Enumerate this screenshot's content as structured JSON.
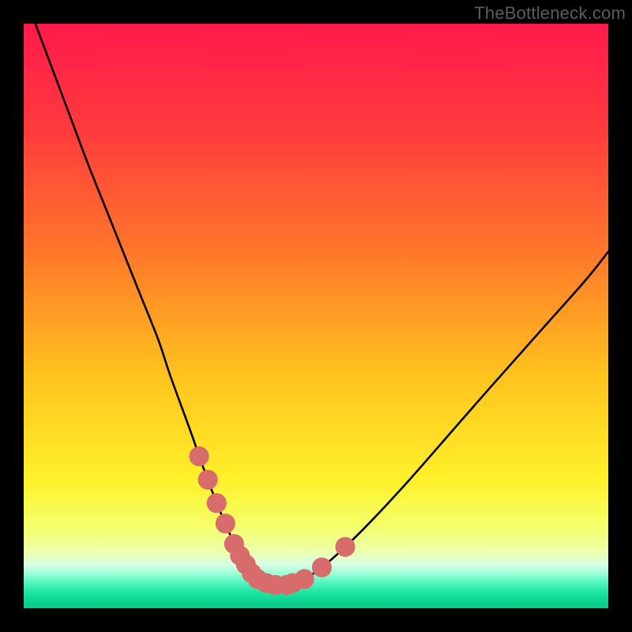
{
  "watermark": "TheBottleneck.com",
  "colors": {
    "frame": "#000000",
    "curve": "#000000",
    "marker": "#d86b6b",
    "gradient_stops": [
      {
        "offset": 0.0,
        "color": "#ff1a4b"
      },
      {
        "offset": 0.18,
        "color": "#ff3a3d"
      },
      {
        "offset": 0.4,
        "color": "#ff7a2a"
      },
      {
        "offset": 0.6,
        "color": "#ffc21e"
      },
      {
        "offset": 0.78,
        "color": "#fff12a"
      },
      {
        "offset": 0.86,
        "color": "#f4ff6a"
      },
      {
        "offset": 0.905,
        "color": "#ecffb0"
      },
      {
        "offset": 0.925,
        "color": "#d8ffe6"
      },
      {
        "offset": 0.94,
        "color": "#9fffd8"
      },
      {
        "offset": 0.955,
        "color": "#57f7c2"
      },
      {
        "offset": 0.972,
        "color": "#1fe6a3"
      },
      {
        "offset": 0.986,
        "color": "#0fd692"
      },
      {
        "offset": 1.0,
        "color": "#07c983"
      }
    ]
  },
  "chart_data": {
    "type": "line",
    "title": "",
    "xlabel": "",
    "ylabel": "",
    "xlim": [
      0,
      100
    ],
    "ylim": [
      0,
      100
    ],
    "series": [
      {
        "name": "bottleneck-curve",
        "x": [
          2,
          5,
          8,
          11,
          14,
          17,
          20,
          23,
          25,
          27,
          29,
          30,
          31.5,
          33,
          34.5,
          36,
          37,
          38,
          39,
          40,
          41.5,
          43,
          45,
          46,
          48,
          51,
          55,
          60,
          66,
          73,
          80,
          88,
          96,
          100
        ],
        "y": [
          100,
          92,
          84,
          76,
          68.5,
          61,
          53.5,
          46,
          40,
          34.5,
          29,
          26,
          22,
          18,
          14.5,
          11,
          9,
          7.5,
          6,
          5,
          4.3,
          4,
          4,
          4.3,
          5,
          7,
          10.5,
          15.5,
          22,
          30,
          38,
          47,
          56,
          61
        ],
        "highlight_indices": [
          11,
          12,
          13,
          14,
          15,
          16,
          17,
          18,
          19,
          20,
          21,
          22,
          23,
          24,
          25,
          26
        ]
      }
    ]
  }
}
